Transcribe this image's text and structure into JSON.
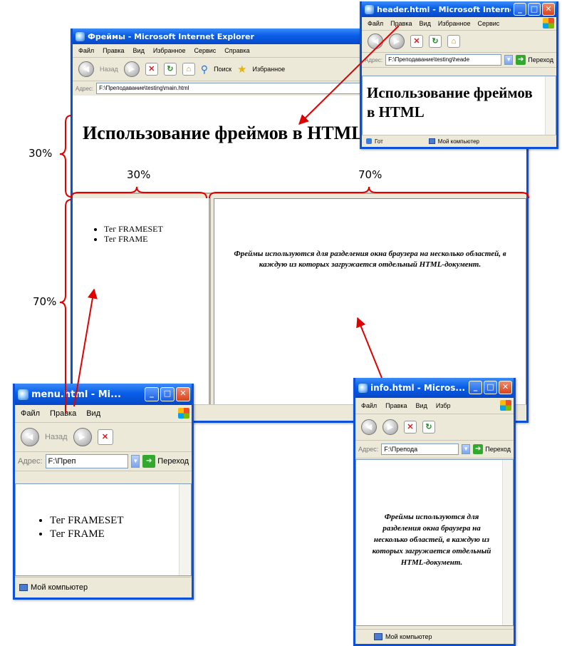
{
  "main_window": {
    "title": "Фреймы - Microsoft Internet Explorer",
    "menu": [
      "Файл",
      "Правка",
      "Вид",
      "Избранное",
      "Сервис",
      "Справка"
    ],
    "toolbar": {
      "back_label": "Назад",
      "search_label": "Поиск",
      "favorites_label": "Избранное"
    },
    "address_label": "Адрес:",
    "address_value": "F:\\Преподавание\\testing\\main.html",
    "header_frame": {
      "heading": "Использование фреймов в HTML"
    },
    "menu_frame": {
      "items": [
        "Тег FRAMESET",
        "Тег FRAME"
      ]
    },
    "info_frame": {
      "text": "Фреймы используются для разделения окна браузера на несколько областей, в каждую из которых загружается отдельный HTML-документ."
    }
  },
  "header_window": {
    "title": "header.html - Microsoft Internet E...",
    "menu": [
      "Файл",
      "Правка",
      "Вид",
      "Избранное",
      "Сервис"
    ],
    "address_label": "Адрес:",
    "address_value": "F:\\Преподавание\\testing\\heade",
    "go_label": "Переход",
    "heading": "Использование фреймов в HTML",
    "status_left": "Гот",
    "status_zone": "Мой компьютер"
  },
  "menu_window": {
    "title": "menu.html - Mi...",
    "menu": [
      "Файл",
      "Правка",
      "Вид"
    ],
    "back_label": "Назад",
    "address_label": "Адрес:",
    "address_value": "F:\\Преп",
    "go_label": "Переход",
    "items": [
      "Тег FRAMESET",
      "Тег FRAME"
    ],
    "status": "Мой компьютер"
  },
  "info_window": {
    "title": "info.html - Micros...",
    "menu": [
      "Файл",
      "Правка",
      "Вид",
      "Избр"
    ],
    "address_label": "Адрес:",
    "address_value": "F:\\Препода",
    "go_label": "Переход",
    "text": "Фреймы используются для разделения окна браузера на несколько областей, в каждую из которых загружается отдельный HTML-документ.",
    "status": "Мой компьютер"
  },
  "labels": {
    "row_top": "30%",
    "row_bottom": "70%",
    "col_left": "30%",
    "col_right": "70%"
  },
  "colors": {
    "annotation": "#e00000",
    "xp_blue": "#0a50d8",
    "chrome": "#ece9d8"
  }
}
